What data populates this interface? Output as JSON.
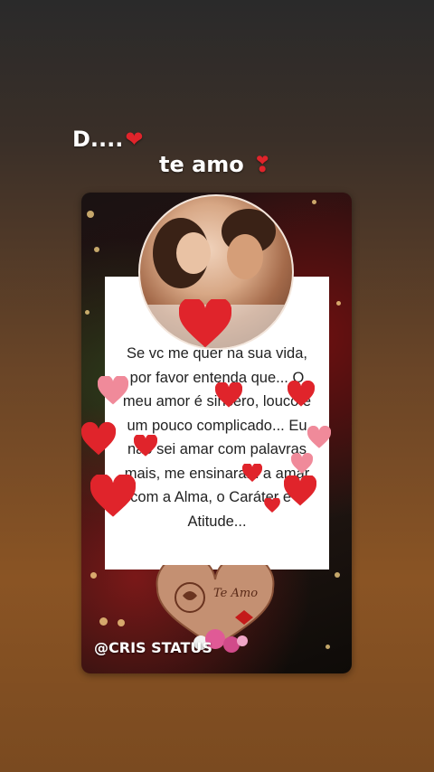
{
  "story": {
    "caption_line1": "D....",
    "caption_line2": "te amo",
    "heart_icon": "red-heart-icon",
    "exclamation_heart_icon": "heart-exclamation-icon"
  },
  "post": {
    "quote": "Se vc me quer na sua vida, por favor entenda que... O meu amor é sincero, louco e um pouco complicado... Eu não sei amar com palavras mais, me ensinaram a amar com a Alma, o Caráter e a Atitude...",
    "badge_text": "Te Amo",
    "watermark": "@CRIS STATUS",
    "photo_icon": "couple-photo"
  },
  "colors": {
    "heart_red": "#e0242b",
    "heart_pink": "#f08a9a",
    "card_bg": "#ffffff"
  }
}
